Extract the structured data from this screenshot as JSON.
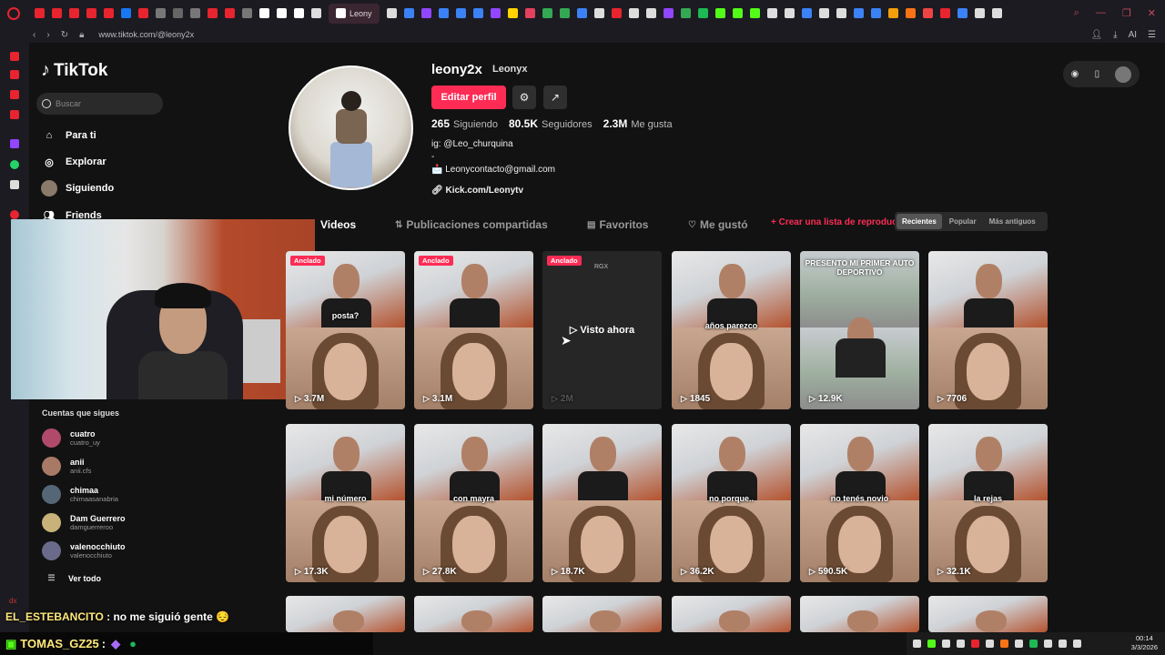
{
  "browser": {
    "active_tab_label": "Leony",
    "url": "www.tiktok.com/@leony2x",
    "tab_colors": [
      "#e8242f",
      "#e8242f",
      "#e8242f",
      "#e8242f",
      "#e8242f",
      "#1877f2",
      "#e8242f",
      "#777",
      "#666",
      "#777",
      "#e8242f",
      "#e8242f",
      "#777",
      "#fff",
      "#fff",
      "#fff",
      "#ddd",
      "#ddd",
      "#3b82f6",
      "#9146ff",
      "#3b82f6",
      "#3b82f6",
      "#3b82f6",
      "#9146ff",
      "#ffd400",
      "#e4405f",
      "#34a853",
      "#34a853",
      "#3b82f6",
      "#ddd",
      "#e8242f",
      "#ddd",
      "#ddd",
      "#9146ff",
      "#34a853",
      "#1db954",
      "#53fc18",
      "#53fc18",
      "#53fc18",
      "#ddd",
      "#ddd",
      "#3b82f6",
      "#ddd",
      "#ddd",
      "#3b82f6",
      "#3b82f6",
      "#f59e0b",
      "#f97316",
      "#ef4444",
      "#e8242f",
      "#3b82f6",
      "#ddd",
      "#ddd"
    ]
  },
  "brand": {
    "name": "TikTok"
  },
  "search": {
    "placeholder": "Buscar"
  },
  "nav": [
    {
      "label": "Para ti",
      "icon": "home-icon"
    },
    {
      "label": "Explorar",
      "icon": "compass-icon"
    },
    {
      "label": "Siguiendo",
      "icon": "avatar-icon"
    },
    {
      "label": "Friends",
      "icon": "friends-icon"
    }
  ],
  "following": {
    "heading": "Cuentas que sigues",
    "accounts": [
      {
        "name": "cuatro",
        "handle": "cuatro_uy",
        "color": "#b04a6a"
      },
      {
        "name": "anii",
        "handle": "anii.cfs",
        "color": "#a87a66"
      },
      {
        "name": "chimaa",
        "handle": "chimaasanabria",
        "color": "#556677"
      },
      {
        "name": "Dam Guerrero",
        "handle": "damguerreroo",
        "color": "#c9b27a"
      },
      {
        "name": "valenocchiuto",
        "handle": "valenocchiuto",
        "color": "#6a6a8a"
      }
    ],
    "see_all": "Ver todo"
  },
  "profile": {
    "username": "leony2x",
    "nickname": "Leonyx",
    "edit_button": "Editar perfil",
    "following_count": "265",
    "following_label": "Siguiendo",
    "followers_count": "80.5K",
    "followers_label": "Seguidores",
    "likes_count": "2.3M",
    "likes_label": "Me gusta",
    "bio_line1": "ig: @Leo_churquina",
    "bio_line2": "-",
    "bio_line3": "📩 Leonycontacto@gmail.com",
    "link": "Kick.com/Leonytv"
  },
  "tabs": {
    "videos": "Videos",
    "shared": "Publicaciones compartidas",
    "favorites": "Favoritos",
    "liked": "Me gustó",
    "create_playlist": "+ Crear una lista de reproducción"
  },
  "sort": {
    "recent": "Recientes",
    "popular": "Popular",
    "oldest": "Más antiguos"
  },
  "videos": [
    {
      "views": "3.7M",
      "pinned": "Anclado",
      "caption": "posta?"
    },
    {
      "views": "3.1M",
      "pinned": "Anclado",
      "caption": ""
    },
    {
      "views": "2M",
      "pinned": "Anclado",
      "watched": "Visto ahora",
      "tag": "RGX"
    },
    {
      "views": "1845",
      "caption": "años parezco"
    },
    {
      "views": "12.9K",
      "caption": "PRESENTO MI PRIMER AUTO DEPORTIVO"
    },
    {
      "views": "7706",
      "caption": ""
    },
    {
      "views": "17.3K",
      "caption": "mi número"
    },
    {
      "views": "27.8K",
      "caption": "con mayra"
    },
    {
      "views": "18.7K",
      "caption": ""
    },
    {
      "views": "36.2K",
      "caption": "no porque.."
    },
    {
      "views": "590.5K",
      "caption": "no tenés novio"
    },
    {
      "views": "32.1K",
      "caption": "la rejas"
    }
  ],
  "overlay": {
    "chat1_user": "EL_ESTEBANCITO",
    "chat1_msg": ": no me siguió gente 😔",
    "chat2_user": "TOMAS_GZ25",
    "chat2_msg": ":",
    "lang": "dx"
  },
  "taskbar": {
    "time": "00:14",
    "date": "3/3/2026"
  }
}
